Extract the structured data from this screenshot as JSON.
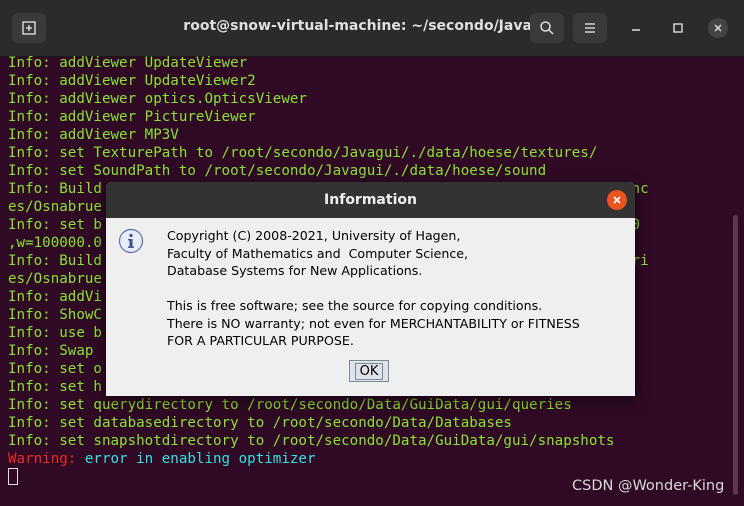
{
  "window": {
    "title": "root@snow-virtual-machine: ~/secondo/Javagui",
    "icons": [
      "new-tab-icon",
      "search-icon",
      "hamburger-menu-icon",
      "minimize-icon",
      "maximize-icon",
      "close-icon"
    ]
  },
  "terminal": {
    "lines": [
      "Info: addViewer UpdateViewer",
      "Info: addViewer UpdateViewer2",
      "Info: addViewer optics.OpticsViewer",
      "Info: addViewer PictureViewer",
      "Info: addViewer MP3V",
      "Info: set TexturePath to /root/secondo/Javagui/./data/hoese/textures/",
      "Info: set SoundPath to /root/secondo/Javagui/./data/hoese/sound",
      "Info: Build                                                     se/referenc",
      "es/Osnabrue",
      "Info: set b                                                     y=-50000.0",
      ",w=100000.0",
      "Info: Build                                                     se/categori",
      "es/Osnabrue",
      "Info: addVi",
      "Info: ShowC",
      "Info: use b",
      "Info: Swap",
      "Info: set o",
      "Info: set h",
      "Info: set querydirectory to /root/secondo/Data/GuiData/gui/queries",
      "Info: set databasedirectory to /root/secondo/Data/Databases",
      "Info: set snapshotdirectory to /root/secondo/Data/GuiData/gui/snapshots"
    ],
    "warning_label": "Warning:",
    "warning_text": " error in enabling optimizer"
  },
  "dialog": {
    "title": "Information",
    "message_lines": [
      "Copyright (C) 2008-2021, University of Hagen,",
      "Faculty of Mathematics and  Computer Science,",
      "Database Systems for New Applications.",
      "",
      "This is free software; see the source for copying conditions.",
      "There is NO warranty; not even for MERCHANTABILITY or FITNESS",
      "FOR A PARTICULAR PURPOSE."
    ],
    "ok_label": "OK",
    "icon": "info-icon"
  },
  "watermark": "CSDN @Wonder-King",
  "colors": {
    "terminal_bg": "#300a24",
    "terminal_text": "#8ae234",
    "warning": "#ef2929",
    "cyan": "#34e2e2",
    "close_button": "#e95420"
  }
}
